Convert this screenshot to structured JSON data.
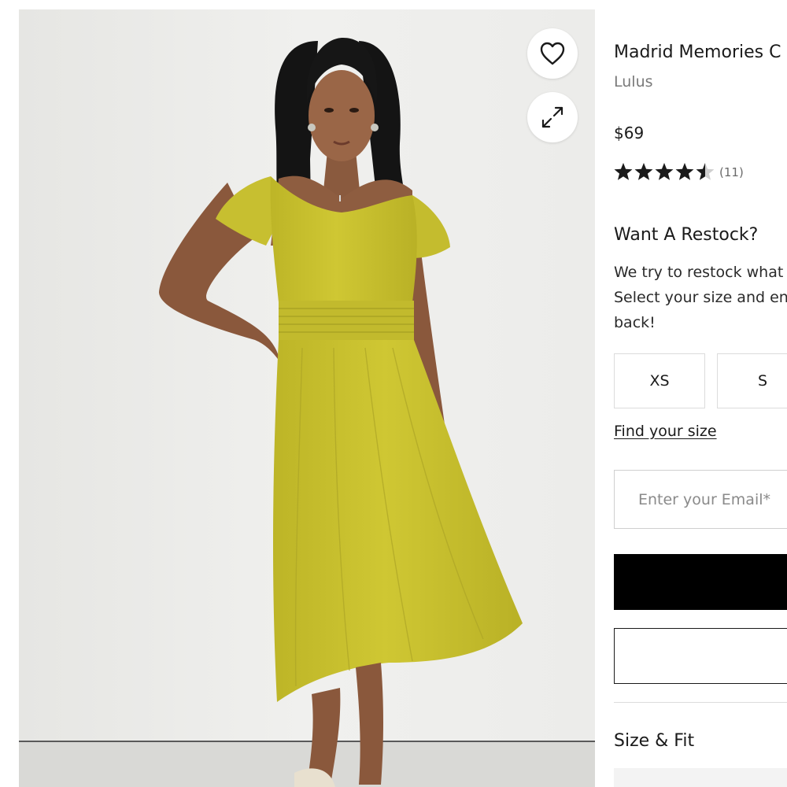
{
  "product": {
    "title": "Madrid Memories C",
    "brand": "Lulus",
    "price": "$69",
    "rating": 4.5,
    "review_count": "(11)",
    "image_alt": "Model wearing chartreuse yellow flutter sleeve midi dress"
  },
  "gallery": {
    "wishlist_icon": "heart-icon",
    "expand_icon": "expand-icon"
  },
  "restock": {
    "heading": "Want A Restock?",
    "lines": [
      "We try to restock what",
      "Select your size and en",
      "back!"
    ]
  },
  "sizes": [
    {
      "label": "XS"
    },
    {
      "label": "S"
    }
  ],
  "find_size_label": "Find your size",
  "email": {
    "placeholder": "Enter your Email*",
    "value": ""
  },
  "size_fit_heading": "Size & Fit",
  "colors": {
    "dress": "#c9c22e",
    "accent_black": "#000000",
    "muted_text": "#7a7a7a",
    "star": "#1a1a1a"
  }
}
